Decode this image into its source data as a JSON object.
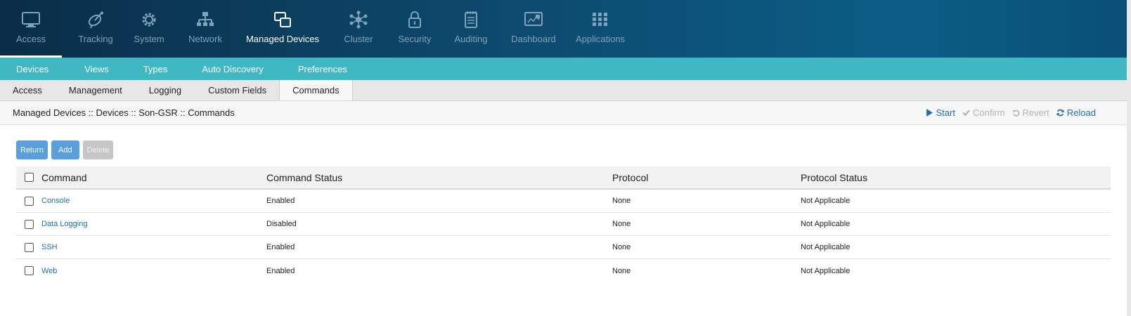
{
  "topnav": {
    "items": [
      {
        "label": "Access",
        "icon": "monitor-icon"
      },
      {
        "label": "Tracking",
        "icon": "satellite-icon"
      },
      {
        "label": "System",
        "icon": "gear-icon"
      },
      {
        "label": "Network",
        "icon": "network-icon"
      },
      {
        "label": "Managed Devices",
        "icon": "devices-icon"
      },
      {
        "label": "Cluster",
        "icon": "cluster-icon"
      },
      {
        "label": "Security",
        "icon": "lock-icon"
      },
      {
        "label": "Auditing",
        "icon": "notepad-icon"
      },
      {
        "label": "Dashboard",
        "icon": "dashboard-icon"
      },
      {
        "label": "Applications",
        "icon": "grid-icon"
      }
    ]
  },
  "subnav": {
    "items": [
      "Devices",
      "Views",
      "Types",
      "Auto Discovery",
      "Preferences"
    ]
  },
  "tabs": {
    "items": [
      "Access",
      "Management",
      "Logging",
      "Custom Fields",
      "Commands"
    ]
  },
  "breadcrumb": "Managed Devices :: Devices :: Son-GSR :: Commands",
  "actions": {
    "start": "Start",
    "confirm": "Confirm",
    "revert": "Revert",
    "reload": "Reload"
  },
  "buttons": {
    "return": "Return",
    "add": "Add",
    "delete": "Delete"
  },
  "table": {
    "headers": {
      "command": "Command",
      "command_status": "Command Status",
      "protocol": "Protocol",
      "protocol_status": "Protocol Status"
    },
    "rows": [
      {
        "command": "Console",
        "command_status": "Enabled",
        "protocol": "None",
        "protocol_status": "Not Applicable"
      },
      {
        "command": "Data Logging",
        "command_status": "Disabled",
        "protocol": "None",
        "protocol_status": "Not Applicable"
      },
      {
        "command": "SSH",
        "command_status": "Enabled",
        "protocol": "None",
        "protocol_status": "Not Applicable"
      },
      {
        "command": "Web",
        "command_status": "Enabled",
        "protocol": "None",
        "protocol_status": "Not Applicable"
      }
    ]
  },
  "colors": {
    "topnav_bg": "#0d4a6e",
    "subnav_bg": "#3fb8c4",
    "link": "#1f6fae",
    "button": "#5aa0dc"
  }
}
